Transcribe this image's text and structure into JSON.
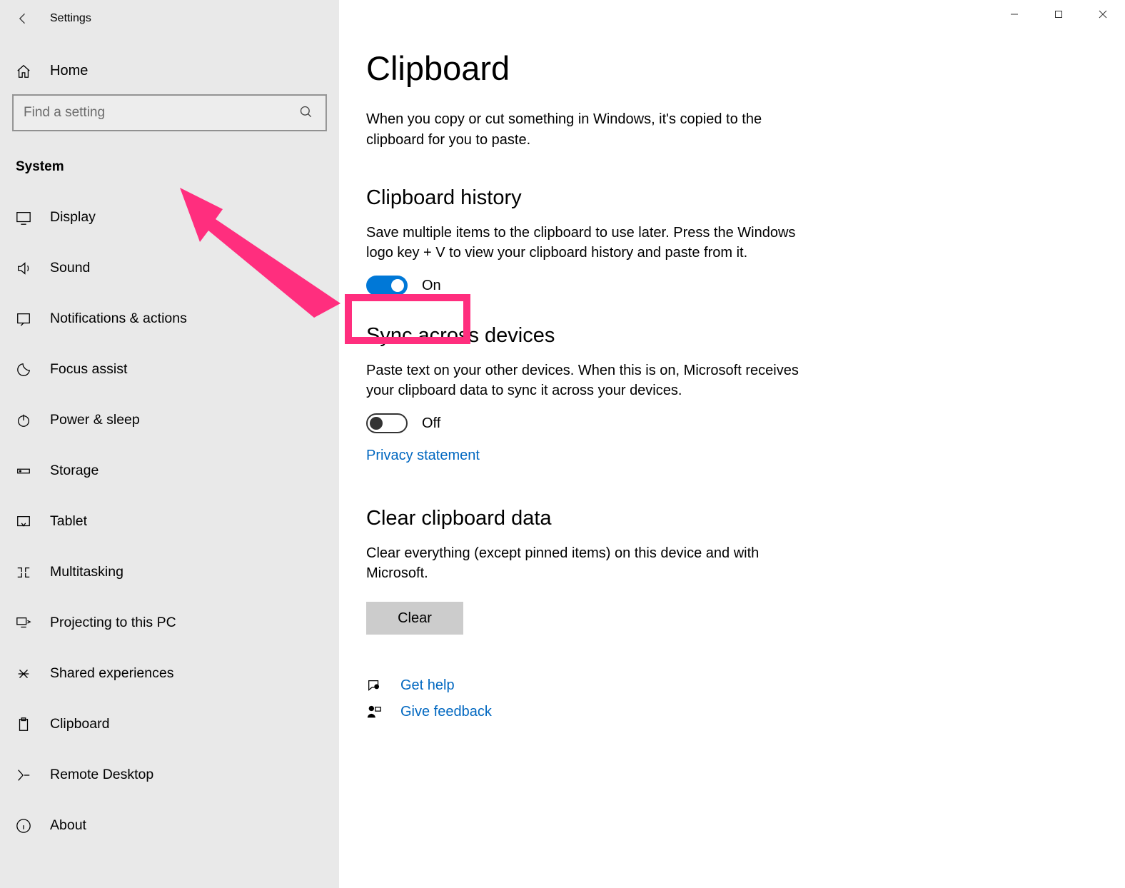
{
  "window": {
    "title": "Settings"
  },
  "sidebar": {
    "home_label": "Home",
    "search_placeholder": "Find a setting",
    "group_label": "System",
    "items": [
      {
        "label": "Display",
        "icon": "display-icon"
      },
      {
        "label": "Sound",
        "icon": "sound-icon"
      },
      {
        "label": "Notifications & actions",
        "icon": "notifications-icon"
      },
      {
        "label": "Focus assist",
        "icon": "moon-icon"
      },
      {
        "label": "Power & sleep",
        "icon": "power-icon"
      },
      {
        "label": "Storage",
        "icon": "storage-icon"
      },
      {
        "label": "Tablet",
        "icon": "tablet-icon"
      },
      {
        "label": "Multitasking",
        "icon": "multitasking-icon"
      },
      {
        "label": "Projecting to this PC",
        "icon": "projecting-icon"
      },
      {
        "label": "Shared experiences",
        "icon": "shared-icon"
      },
      {
        "label": "Clipboard",
        "icon": "clipboard-icon"
      },
      {
        "label": "Remote Desktop",
        "icon": "remote-icon"
      },
      {
        "label": "About",
        "icon": "about-icon"
      }
    ]
  },
  "main": {
    "title": "Clipboard",
    "intro": "When you copy or cut something in Windows, it's copied to the clipboard for you to paste.",
    "history": {
      "title": "Clipboard history",
      "desc": "Save multiple items to the clipboard to use later. Press the Windows logo key + V to view your clipboard history and paste from it.",
      "toggle_state": "On"
    },
    "sync": {
      "title": "Sync across devices",
      "desc": "Paste text on your other devices. When this is on, Microsoft receives your clipboard data to sync it across your devices.",
      "toggle_state": "Off",
      "privacy_link": "Privacy statement"
    },
    "clear": {
      "title": "Clear clipboard data",
      "desc": "Clear everything (except pinned items) on this device and with Microsoft.",
      "button": "Clear"
    },
    "help": {
      "get_help": "Get help",
      "feedback": "Give feedback"
    }
  },
  "annotation": {
    "color": "#ff2e7e",
    "highlights": "clipboard-history-toggle"
  }
}
